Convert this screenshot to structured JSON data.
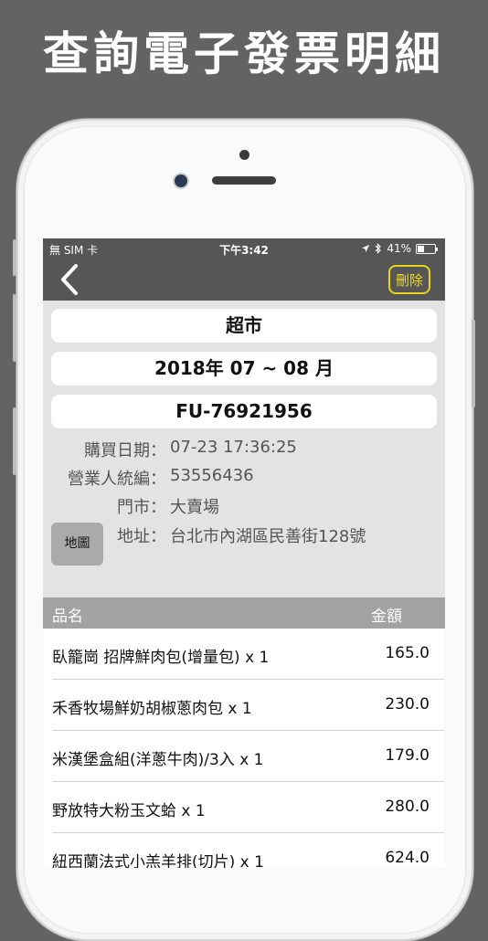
{
  "banner": {
    "title": "查詢電子發票明細"
  },
  "status_bar": {
    "carrier": "無 SIM 卡",
    "time": "下午3:42",
    "battery": "41%",
    "battery_level": 0.41
  },
  "nav": {
    "back_icon": "chevron-left-icon",
    "delete_label": "刪除"
  },
  "invoice": {
    "store_type": "超市",
    "period": "2018年 07 ~ 08 月",
    "number": "FU-76921956"
  },
  "details": [
    {
      "label": "購買日期：",
      "value": "07-23 17:36:25"
    },
    {
      "label": "營業人統編：",
      "value": "53556436"
    },
    {
      "label": "門市：",
      "value": "大賣場"
    },
    {
      "label": "地址：",
      "value": "台北市內湖區民善街128號"
    }
  ],
  "map_button": {
    "label": "地圖"
  },
  "table": {
    "headers": {
      "name": "品名",
      "amount": "金額"
    },
    "rows": [
      {
        "name": "臥籠崗 招牌鮮肉包(增量包) x 1",
        "amount": "165.0"
      },
      {
        "name": "禾香牧場鮮奶胡椒蔥肉包 x 1",
        "amount": "230.0"
      },
      {
        "name": "米漢堡盒組(洋蔥牛肉)/3入 x 1",
        "amount": "179.0"
      },
      {
        "name": "野放特大粉玉文蛤 x 1",
        "amount": "280.0"
      },
      {
        "name": "紐西蘭法式小羔羊排(切片) x 1",
        "amount": "624.0"
      }
    ]
  },
  "colors": {
    "background": "#636363",
    "nav_bar": "#565656",
    "delete_accent": "#e9d51a",
    "screen_bg": "#e3e3e3",
    "table_header": "#a3a3a3"
  }
}
